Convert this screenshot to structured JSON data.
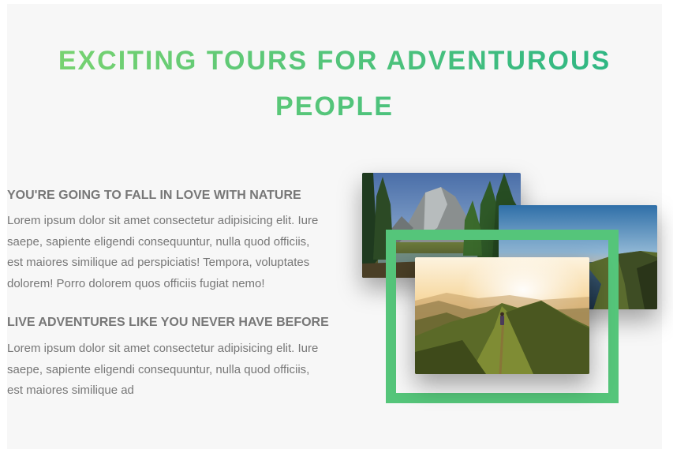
{
  "section": {
    "heading": "EXCITING TOURS FOR ADVENTUROUS PEOPLE",
    "accent_color": "#55c57a"
  },
  "features": [
    {
      "title": "YOU'RE GOING TO FALL IN LOVE WITH NATURE",
      "text": "Lorem ipsum dolor sit amet consectetur adipisicing elit. Iure saepe, sapiente eligendi consequuntur, nulla quod officiis, est maiores similique ad perspiciatis! Tempora, voluptates dolorem! Porro dolorem quos officiis fugiat nemo!"
    },
    {
      "title": "LIVE ADVENTURES LIKE YOU NEVER HAVE BEFORE",
      "text": "Lorem ipsum dolor sit amet consectetur adipisicing elit. Iure saepe, sapiente eligendi consequuntur, nulla quod officiis, est maiores similique ad"
    }
  ],
  "composition": {
    "photos": [
      {
        "name": "mountain-valley-photo"
      },
      {
        "name": "coastal-cliffs-photo"
      },
      {
        "name": "mountain-ridge-hiker-photo",
        "highlighted": true
      }
    ]
  }
}
